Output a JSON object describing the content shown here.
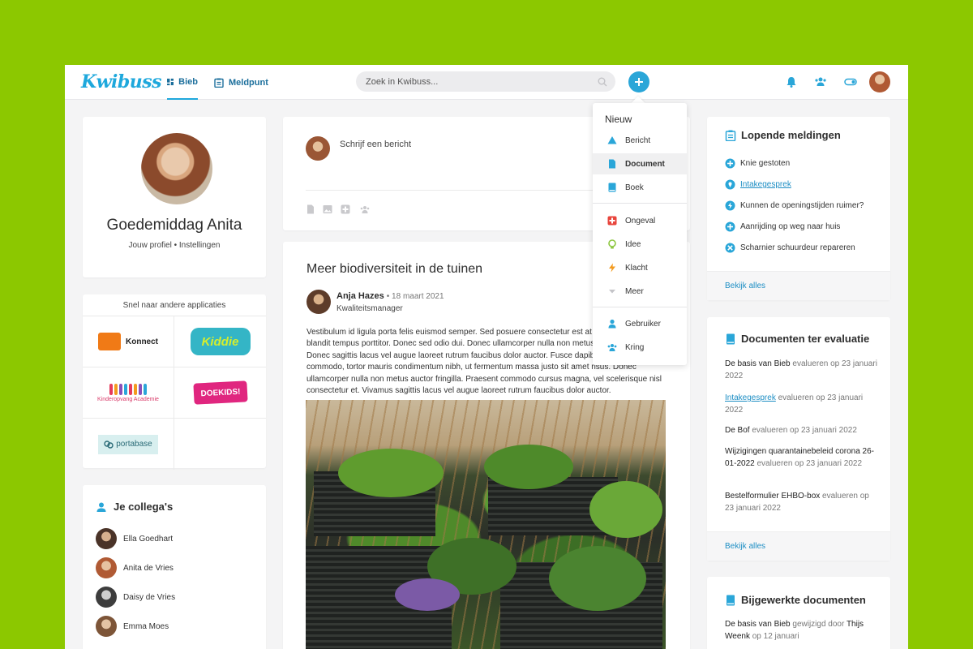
{
  "header": {
    "logo": "Kwibuss",
    "nav": [
      {
        "label": "Bieb",
        "icon": "grid-icon"
      },
      {
        "label": "Meldpunt",
        "icon": "clipboard-icon"
      }
    ],
    "search_placeholder": "Zoek in Kwibuss...",
    "icons": [
      "bell-icon",
      "users-icon",
      "toggle-icon"
    ],
    "accent_color": "#1ea8dc"
  },
  "profile": {
    "greeting": "Goedemiddag Anita",
    "links": "Jouw profiel • Instellingen"
  },
  "apps": {
    "title": "Snel naar andere applicaties",
    "items": [
      "Konnect",
      "Kiddie",
      "Kinderopvang Academie",
      "DOEKIDS!",
      "portabase"
    ]
  },
  "colleagues": {
    "title": "Je collega's",
    "items": [
      "Ella Goedhart",
      "Anita de Vries",
      "Daisy de Vries",
      "Emma Moes"
    ]
  },
  "composer": {
    "placeholder": "Schrijf een bericht"
  },
  "post": {
    "title": "Meer biodiversiteit in de tuinen",
    "author": "Anja Hazes",
    "date": "• 18 maart 2021",
    "role": "Kwaliteitsmanager",
    "body": "Vestibulum id ligula porta felis euismod semper. Sed posuere consectetur est at lobortis. Curabitur blandit tempus porttitor. Donec sed odio dui. Donec ullamcorper nulla non metus auctor fringilla. Donec sagittis lacus vel augue laoreet rutrum faucibus dolor auctor. Fusce dapibus, tellus ac cursus commodo, tortor mauris condimentum nibh, ut fermentum massa justo sit amet risus. Donec ullamcorper nulla non metus auctor fringilla. Praesent commodo cursus magna, vel scelerisque nisl consectetur et. Vivamus sagittis lacus vel augue laoreet rutrum faucibus dolor auctor."
  },
  "dropdown": {
    "title": "Nieuw",
    "items": [
      {
        "label": "Bericht",
        "icon": "message-icon"
      },
      {
        "label": "Document",
        "icon": "document-icon"
      },
      {
        "label": "Boek",
        "icon": "book-icon"
      },
      {
        "label": "Ongeval",
        "icon": "first-aid-icon"
      },
      {
        "label": "Idee",
        "icon": "lightbulb-icon"
      },
      {
        "label": "Klacht",
        "icon": "lightning-icon"
      },
      {
        "label": "Meer",
        "icon": "chevron-down-icon"
      },
      {
        "label": "Gebruiker",
        "icon": "user-icon"
      },
      {
        "label": "Kring",
        "icon": "group-icon"
      }
    ]
  },
  "meldingen": {
    "title": "Lopende meldingen",
    "items": [
      {
        "label": "Knie gestoten",
        "icon": "plus-circle-icon"
      },
      {
        "label": "Intakegesprek",
        "icon": "pin-icon"
      },
      {
        "label": "Kunnen de openingstijden ruimer?",
        "icon": "lightning-icon"
      },
      {
        "label": "Aanrijding op weg naar huis",
        "icon": "plus-circle-icon"
      },
      {
        "label": "Scharnier schuurdeur repareren",
        "icon": "wrench-icon"
      }
    ],
    "footer": "Bekijk alles"
  },
  "evaluatie": {
    "title": "Documenten ter evaluatie",
    "items": [
      {
        "name": "De basis van Bieb",
        "suffix": "evalueren op 23 januari 2022"
      },
      {
        "name": "Intakegesprek",
        "suffix": "evalueren op 23 januari 2022"
      },
      {
        "name": "De Bof",
        "suffix": "evalueren op 23 januari 2022"
      },
      {
        "name": "Wijzigingen quarantainebeleid corona 26-01-2022",
        "suffix": "evalueren op 23 januari 2022"
      },
      {
        "name": "Bestelformulier EHBO-box",
        "suffix": "evalueren op 23 januari 2022"
      }
    ],
    "footer": "Bekijk alles"
  },
  "bijgewerkt": {
    "title": "Bijgewerkte documenten",
    "items": [
      {
        "name": "De basis van Bieb",
        "mid": "gewijzigd door",
        "who": "Thijs Weenk",
        "suffix": "op 12 januari"
      }
    ]
  }
}
